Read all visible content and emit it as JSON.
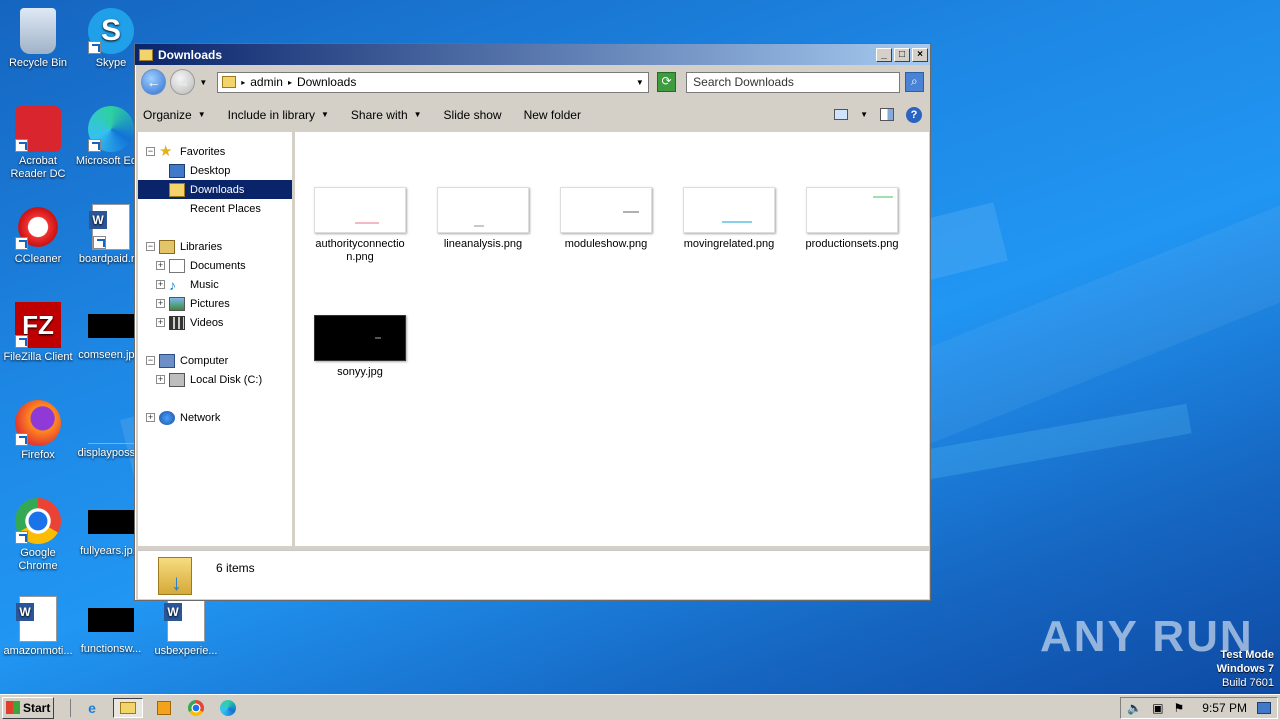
{
  "desktop": {
    "icons": [
      {
        "label": "Recycle Bin"
      },
      {
        "label": "Skype"
      },
      {
        "label": "Acrobat Reader DC"
      },
      {
        "label": "Microsoft Ed..."
      },
      {
        "label": "CCleaner"
      },
      {
        "label": "boardpaid.r..."
      },
      {
        "label": "FileZilla Client"
      },
      {
        "label": "comseen.jp..."
      },
      {
        "label": "Firefox"
      },
      {
        "label": "displayposs..."
      },
      {
        "label": "Google Chrome"
      },
      {
        "label": "fullyears.jp..."
      },
      {
        "label": "amazonmoti..."
      },
      {
        "label": "functionsw..."
      },
      {
        "label": "usbexperie..."
      }
    ],
    "watermark": "ANY RUN",
    "test_mode": {
      "line1": "Test Mode",
      "line2": "Windows 7",
      "line3": "Build 7601"
    }
  },
  "window": {
    "title": "Downloads",
    "breadcrumb": [
      "admin",
      "Downloads"
    ],
    "search_placeholder": "Search Downloads",
    "toolbar": {
      "organize": "Organize",
      "include_in_library": "Include in library",
      "share_with": "Share with",
      "slide_show": "Slide show",
      "new_folder": "New folder"
    },
    "nav": {
      "favorites": "Favorites",
      "desktop": "Desktop",
      "downloads": "Downloads",
      "recent_places": "Recent Places",
      "libraries": "Libraries",
      "documents": "Documents",
      "music": "Music",
      "pictures": "Pictures",
      "videos": "Videos",
      "computer": "Computer",
      "local_disk": "Local Disk (C:)",
      "network": "Network"
    },
    "files": [
      {
        "name": "authorityconnection.png",
        "line1": "authorityconnectio",
        "line2": "n.png"
      },
      {
        "name": "lineanalysis.png",
        "line1": "lineanalysis.png"
      },
      {
        "name": "moduleshow.png",
        "line1": "moduleshow.png"
      },
      {
        "name": "movingrelated.png",
        "line1": "movingrelated.png"
      },
      {
        "name": "productionsets.png",
        "line1": "productionsets.png"
      },
      {
        "name": "sonyy.jpg",
        "line1": "sonyy.jpg"
      }
    ],
    "status": "6 items"
  },
  "taskbar": {
    "start": "Start",
    "clock": "9:57 PM"
  }
}
